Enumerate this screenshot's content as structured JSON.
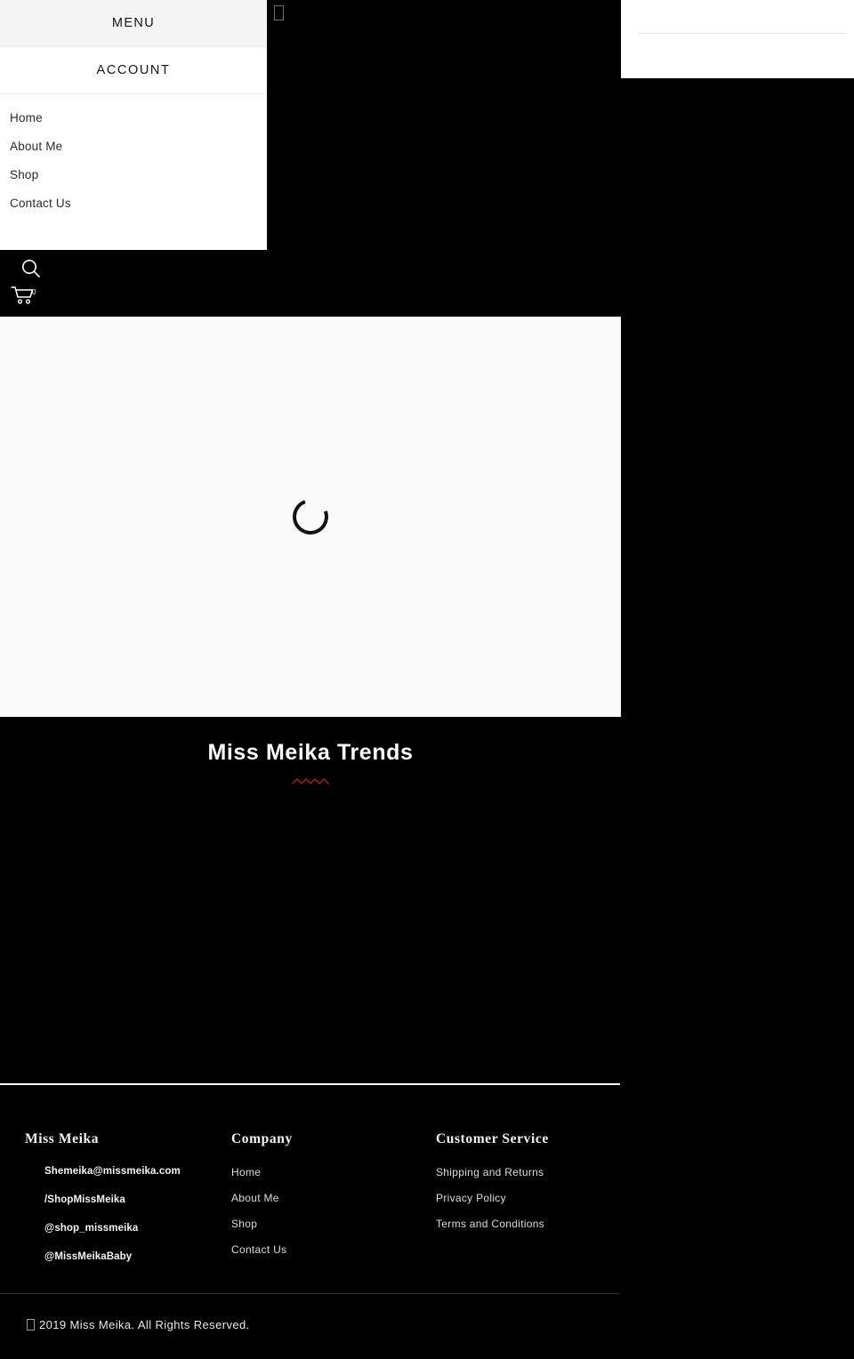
{
  "account_panel": {
    "name": "account-dropdown-panel",
    "row_top_label": "",
    "row_bottom_label": ""
  },
  "drawer": {
    "menu_header_label": "MENU",
    "account_header_label": "ACCOUNT",
    "items": [
      {
        "label": "Home"
      },
      {
        "label": "About Me"
      },
      {
        "label": "Shop"
      },
      {
        "label": "Contact Us"
      }
    ]
  },
  "icons": {
    "search": "search-icon",
    "cart": "shopping-cart-icon",
    "cart_count": "0",
    "missing_glyph": "missing-glyph-box"
  },
  "main": {
    "loading_state": "spinner",
    "trends_title": "Miss Meika Trends",
    "squiggle_color": "#8f1d24"
  },
  "footer": {
    "brand": {
      "heading": "Miss Meika",
      "contacts": [
        {
          "label": "Shemeika@missmeika.com",
          "icon": "email-icon"
        },
        {
          "label": "/ShopMissMeika",
          "icon": "facebook-icon"
        },
        {
          "label": "@shop_missmeika",
          "icon": "instagram-icon"
        },
        {
          "label": "@MissMeikaBaby",
          "icon": "twitter-icon"
        }
      ]
    },
    "company": {
      "heading": "Company",
      "links": [
        {
          "label": "Home"
        },
        {
          "label": "About Me"
        },
        {
          "label": "Shop"
        },
        {
          "label": "Contact Us"
        }
      ]
    },
    "customer_service": {
      "heading": "Customer Service",
      "links": [
        {
          "label": "Shipping and Returns"
        },
        {
          "label": "Privacy Policy"
        },
        {
          "label": "Terms and Conditions"
        }
      ]
    },
    "copyright": "2019 Miss Meika. All Rights Reserved."
  }
}
